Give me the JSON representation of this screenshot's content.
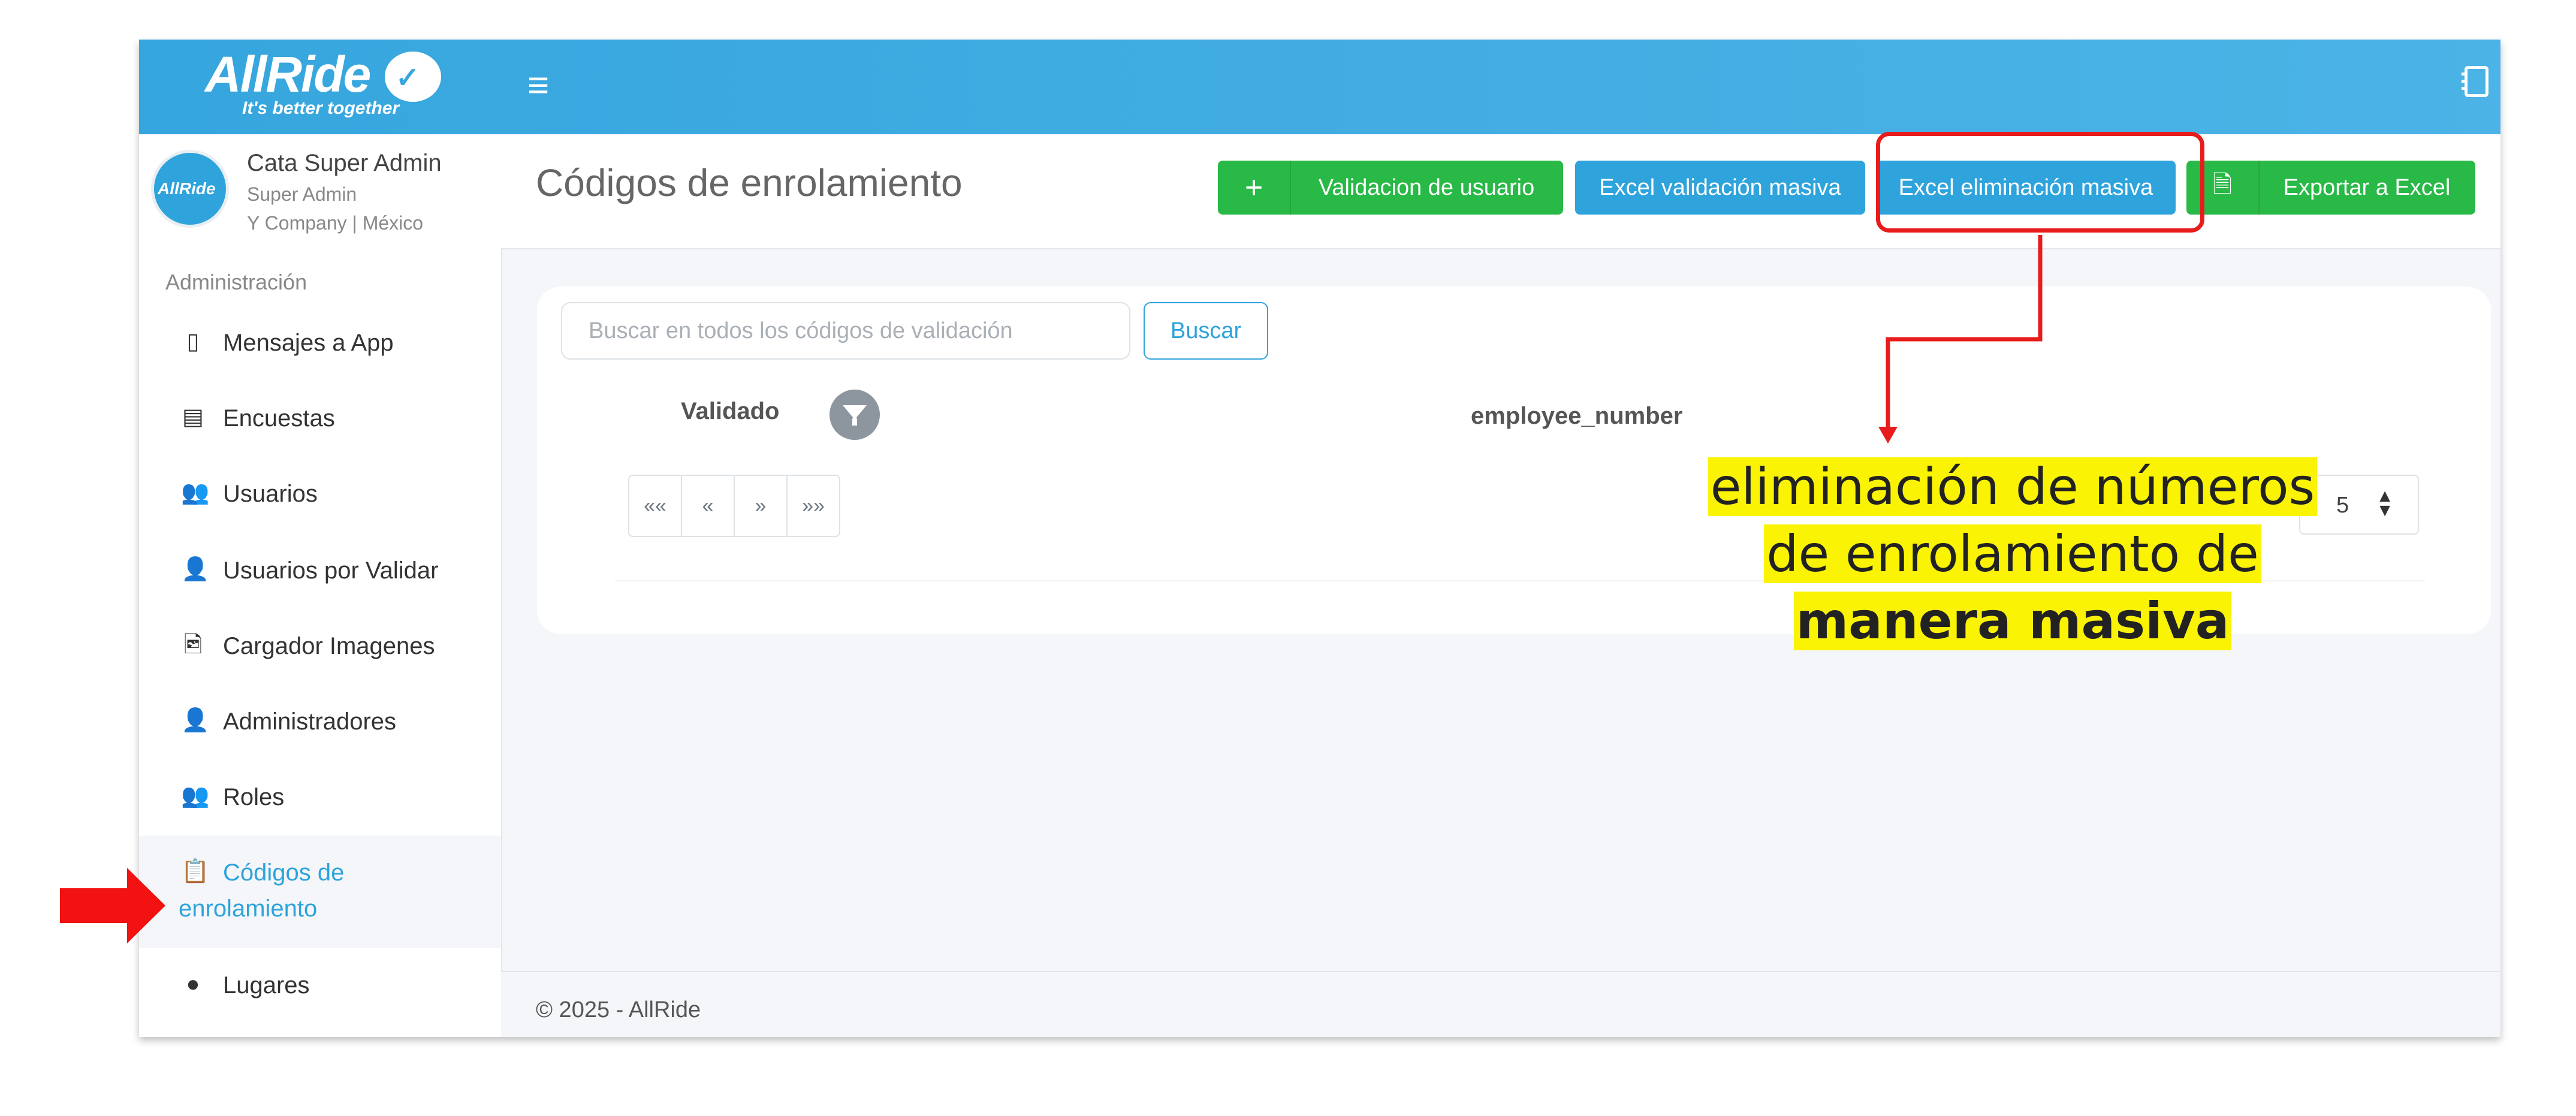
{
  "brand": {
    "name": "AllRide",
    "tagline": "It's better together"
  },
  "user": {
    "name": "Cata Super Admin",
    "role": "Super Admin",
    "company": "Y Company | México",
    "avatar_text": "AllRide"
  },
  "sidebar": {
    "section_label": "Administración",
    "items": [
      {
        "label": "Mensajes a App",
        "icon": "mobile-icon"
      },
      {
        "label": "Encuestas",
        "icon": "survey-icon"
      },
      {
        "label": "Usuarios",
        "icon": "users-icon"
      },
      {
        "label": "Usuarios por Validar",
        "icon": "user-clock-icon"
      },
      {
        "label": "Cargador Imagenes",
        "icon": "file-image-icon"
      },
      {
        "label": "Administradores",
        "icon": "user-icon"
      },
      {
        "label": "Roles",
        "icon": "users-cog-icon"
      },
      {
        "label_line1": "Códigos de",
        "label_line2": "enrolamiento",
        "icon": "clipboard-list-icon",
        "active": true
      },
      {
        "label": "Lugares",
        "icon": "map-marker-icon"
      }
    ]
  },
  "header": {
    "title": "Códigos de enrolamiento",
    "buttons": {
      "validate_user": "Validacion de usuario",
      "excel_bulk_validate": "Excel validación masiva",
      "excel_bulk_delete": "Excel eliminación masiva",
      "export_excel": "Exportar a Excel"
    }
  },
  "search": {
    "placeholder": "Buscar en todos los códigos de validación",
    "button": "Buscar"
  },
  "table": {
    "columns": [
      "Validado",
      "employee_number"
    ],
    "pager": [
      "««",
      "«",
      "»",
      "»»"
    ],
    "page_size": "5"
  },
  "footer": {
    "text": "© 2025 - AllRide"
  },
  "annotation": {
    "line1": "eliminación de números",
    "line2": "de enrolamiento de",
    "line3": "manera masiva"
  },
  "colors": {
    "primary": "#2ea3dc",
    "success": "#28b946",
    "annotation_red": "#e81c1c",
    "annotation_yellow": "#fbf304"
  }
}
